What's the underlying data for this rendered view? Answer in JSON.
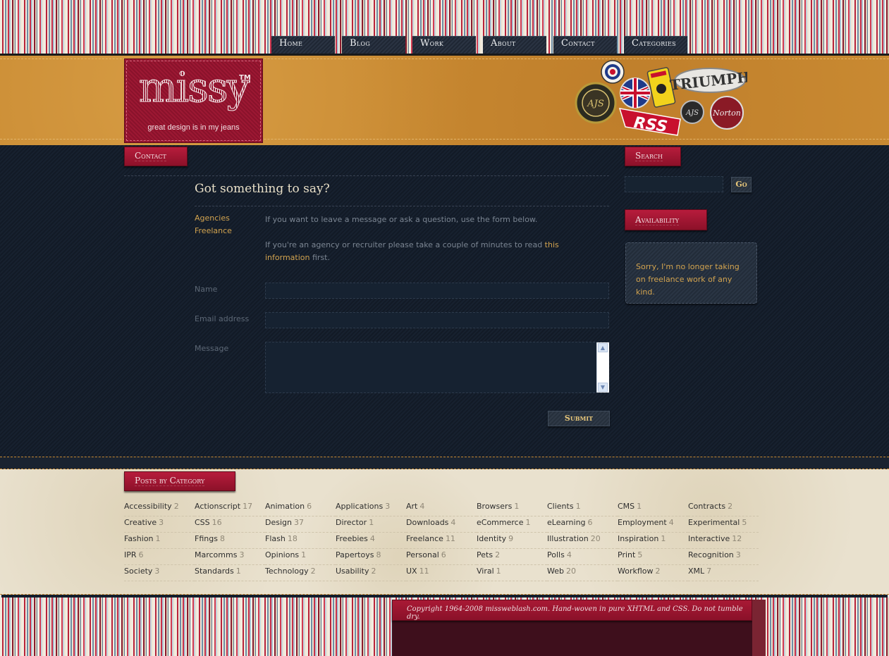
{
  "nav": {
    "items": [
      {
        "label": "Home"
      },
      {
        "label": "Blog"
      },
      {
        "label": "Work"
      },
      {
        "label": "About"
      },
      {
        "label": "Contact"
      },
      {
        "label": "Categories"
      }
    ]
  },
  "logo": {
    "word": "missy",
    "tm": "TM",
    "tagline": "great design is in my jeans"
  },
  "badges": [
    "raf-roundel-icon",
    "ajs-badge-icon",
    "union-jack-icon",
    "vespa-badge-icon",
    "triumph-badge-icon",
    "ajs-small-badge-icon",
    "norton-badge-icon",
    "rss-badge-icon"
  ],
  "contact": {
    "section_title": "Contact",
    "heading": "Got something to say?",
    "side_links": [
      "Agencies",
      "Freelance"
    ],
    "intro": "If you want to leave a message or ask a question, use the form below.",
    "agency_text_before": "If you're an agency or recruiter please take a couple of minutes to read ",
    "agency_link": "this information",
    "agency_text_after": " first.",
    "name_label": "Name",
    "email_label": "Email address",
    "message_label": "Message",
    "submit_label": "Submit"
  },
  "sidebar": {
    "search_title": "Search",
    "go_label": "Go",
    "availability_title": "Availability",
    "availability_text": "Sorry, I'm no longer taking on freelance work of any kind."
  },
  "footer": {
    "categories_title": "Posts by Category",
    "categories": [
      {
        "name": "Accessibility",
        "count": "2"
      },
      {
        "name": "Actionscript",
        "count": "17"
      },
      {
        "name": "Animation",
        "count": "6"
      },
      {
        "name": "Applications",
        "count": "3"
      },
      {
        "name": "Art",
        "count": "4"
      },
      {
        "name": "Browsers",
        "count": "1"
      },
      {
        "name": "Clients",
        "count": "1"
      },
      {
        "name": "CMS",
        "count": "1"
      },
      {
        "name": "Contracts",
        "count": "2"
      },
      {
        "name": "Creative",
        "count": "3"
      },
      {
        "name": "CSS",
        "count": "16"
      },
      {
        "name": "Design",
        "count": "37"
      },
      {
        "name": "Director",
        "count": "1"
      },
      {
        "name": "Downloads",
        "count": "4"
      },
      {
        "name": "eCommerce",
        "count": "1"
      },
      {
        "name": "eLearning",
        "count": "6"
      },
      {
        "name": "Employment",
        "count": "4"
      },
      {
        "name": "Experimental",
        "count": "5"
      },
      {
        "name": "Fashion",
        "count": "1"
      },
      {
        "name": "Ffings",
        "count": "8"
      },
      {
        "name": "Flash",
        "count": "18"
      },
      {
        "name": "Freebies",
        "count": "4"
      },
      {
        "name": "Freelance",
        "count": "11"
      },
      {
        "name": "Identity",
        "count": "9"
      },
      {
        "name": "Illustration",
        "count": "20"
      },
      {
        "name": "Inspiration",
        "count": "1"
      },
      {
        "name": "Interactive",
        "count": "12"
      },
      {
        "name": "IPR",
        "count": "6"
      },
      {
        "name": "Marcomms",
        "count": "3"
      },
      {
        "name": "Opinions",
        "count": "1"
      },
      {
        "name": "Papertoys",
        "count": "8"
      },
      {
        "name": "Personal",
        "count": "6"
      },
      {
        "name": "Pets",
        "count": "2"
      },
      {
        "name": "Polls",
        "count": "4"
      },
      {
        "name": "Print",
        "count": "5"
      },
      {
        "name": "Recognition",
        "count": "3"
      },
      {
        "name": "Society",
        "count": "3"
      },
      {
        "name": "Standards",
        "count": "1"
      },
      {
        "name": "Technology",
        "count": "2"
      },
      {
        "name": "Usability",
        "count": "2"
      },
      {
        "name": "UX",
        "count": "11"
      },
      {
        "name": "Viral",
        "count": "1"
      },
      {
        "name": "Web",
        "count": "20"
      },
      {
        "name": "Workflow",
        "count": "2"
      },
      {
        "name": "XML",
        "count": "7"
      }
    ],
    "copyright": "Copyright  1964-2008 missweblash.com. Hand-woven in pure XHTML and CSS. Do not tumble dry."
  },
  "colors": {
    "ribbon_red": "#a91935",
    "denim_dark": "#131d2b",
    "leather_tan": "#c98a32",
    "link_gold": "#d2a34f"
  }
}
